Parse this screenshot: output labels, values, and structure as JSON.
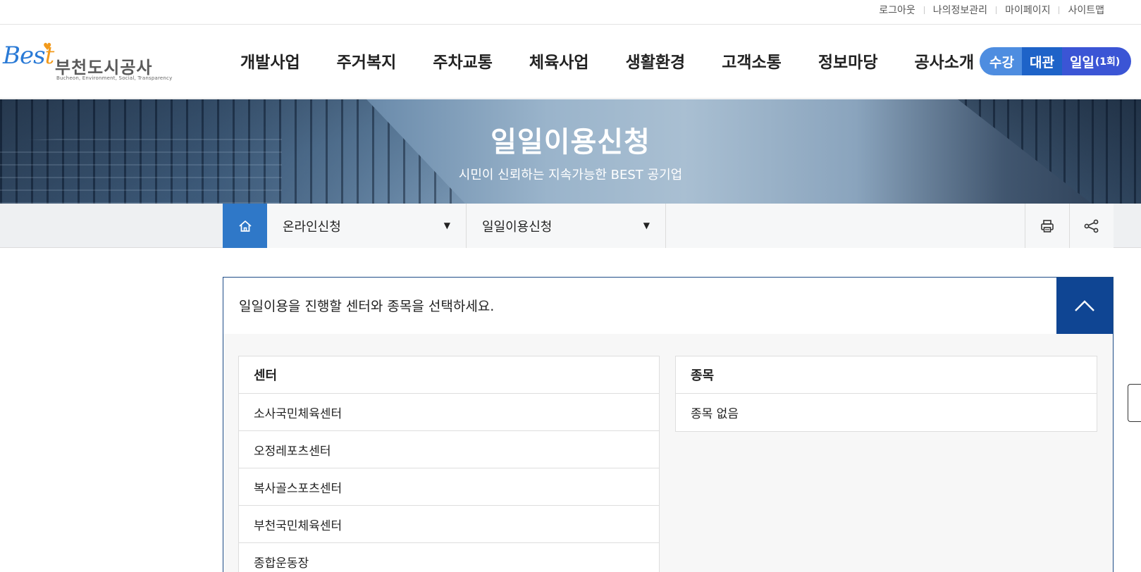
{
  "util_links": [
    "로그아웃",
    "나의정보관리",
    "마이페이지",
    "사이트맵"
  ],
  "logo": {
    "brand": "Best",
    "name": "부천도시공사",
    "tagline": "Bucheon, Environment, Social, Transparency"
  },
  "gnb": [
    "개발사업",
    "주거복지",
    "주차교통",
    "체육사업",
    "생활환경",
    "고객소통",
    "정보마당",
    "공사소개"
  ],
  "quick": {
    "class_label": "수강",
    "rental_label": "대관",
    "daily_label": "일일",
    "daily_count": "(1회)"
  },
  "hero": {
    "title": "일일이용신청",
    "subtitle": "시민이 신뢰하는 지속가능한 BEST 공기업"
  },
  "location": {
    "depth1": "온라인신청",
    "depth2": "일일이용신청"
  },
  "panel": {
    "instruction": "일일이용을 진행할 센터와 종목을 선택하세요.",
    "center_header": "센터",
    "centers": [
      "소사국민체육센터",
      "오정레포츠센터",
      "복사골스포츠센터",
      "부천국민체육센터",
      "종합운동장"
    ],
    "item_header": "종목",
    "items": [
      "종목 없음"
    ]
  },
  "colors": {
    "primary_blue": "#2f78c8",
    "panel_border": "#1d4b86",
    "collapse_button": "#0f4593",
    "pill_light": "#4e8de0",
    "pill_mid": "#1e63c8",
    "pill_violet": "#3b55d5",
    "logo_orange": "#f29a1b"
  },
  "icons": {
    "home": "home-icon",
    "print": "print-icon",
    "share": "share-icon",
    "collapse": "chevron-up-icon"
  }
}
